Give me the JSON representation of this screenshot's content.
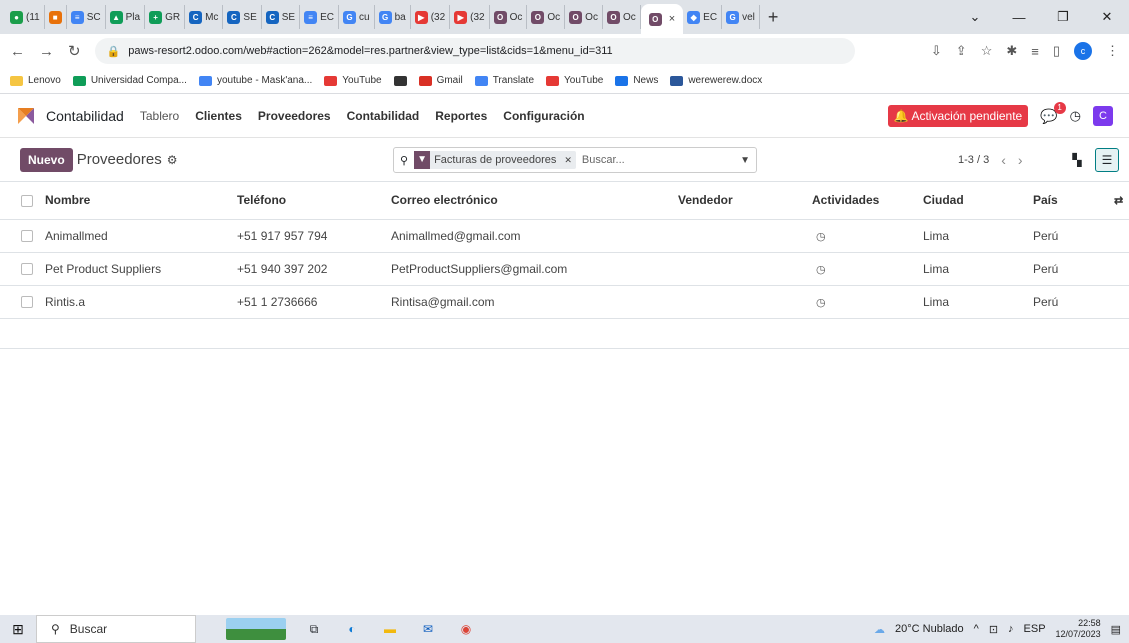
{
  "browser": {
    "tabs": [
      {
        "label": "(11",
        "color": "#1b9e4b",
        "glyph": "●"
      },
      {
        "label": "",
        "color": "#e8710a",
        "glyph": "■"
      },
      {
        "label": "SC",
        "color": "#4285f4",
        "glyph": "≡"
      },
      {
        "label": "Pla",
        "color": "#0f9d58",
        "glyph": "▲"
      },
      {
        "label": "GR",
        "color": "#0f9d58",
        "glyph": "+"
      },
      {
        "label": "Mc",
        "color": "#1565c0",
        "glyph": "C"
      },
      {
        "label": "SE",
        "color": "#1565c0",
        "glyph": "C"
      },
      {
        "label": "SE",
        "color": "#1565c0",
        "glyph": "C"
      },
      {
        "label": "EC",
        "color": "#4285f4",
        "glyph": "≡"
      },
      {
        "label": "cu",
        "color": "#4285f4",
        "glyph": "G"
      },
      {
        "label": "ba",
        "color": "#4285f4",
        "glyph": "G"
      },
      {
        "label": "(32",
        "color": "#e53935",
        "glyph": "▶"
      },
      {
        "label": "(32",
        "color": "#e53935",
        "glyph": "▶"
      },
      {
        "label": "Oc",
        "color": "#714b67",
        "glyph": "O"
      },
      {
        "label": "Oc",
        "color": "#714b67",
        "glyph": "O"
      },
      {
        "label": "Oc",
        "color": "#714b67",
        "glyph": "O"
      },
      {
        "label": "Oc",
        "color": "#714b67",
        "glyph": "O"
      }
    ],
    "active_tab_glyph": "O",
    "after_tabs": [
      {
        "label": "EC",
        "color": "#4285f4",
        "glyph": "◆"
      },
      {
        "label": "vel",
        "color": "#4285f4",
        "glyph": "G"
      }
    ],
    "url": "paws-resort2.odoo.com/web#action=262&model=res.partner&view_type=list&cids=1&menu_id=311",
    "bookmarks": [
      {
        "label": "Lenovo",
        "color": "#f5c542"
      },
      {
        "label": "Universidad Compa...",
        "color": "#0f9d58"
      },
      {
        "label": "youtube - Mask'ana...",
        "color": "#4285f4"
      },
      {
        "label": "YouTube",
        "color": "#e53935"
      },
      {
        "label": "",
        "color": "#333333"
      },
      {
        "label": "Gmail",
        "color": "#d93025"
      },
      {
        "label": "Translate",
        "color": "#4285f4"
      },
      {
        "label": "YouTube",
        "color": "#e53935"
      },
      {
        "label": "News",
        "color": "#1a73e8"
      },
      {
        "label": "werewerew.docx",
        "color": "#2b579a"
      }
    ],
    "profile_initial": "c"
  },
  "odoo": {
    "app_name": "Contabilidad",
    "menu": [
      {
        "label": "Tablero",
        "style": "light"
      },
      {
        "label": "Clientes",
        "style": "bold"
      },
      {
        "label": "Proveedores",
        "style": "bold"
      },
      {
        "label": "Contabilidad",
        "style": "bold"
      },
      {
        "label": "Reportes",
        "style": "bold"
      },
      {
        "label": "Configuración",
        "style": "bold"
      }
    ],
    "activation_label": "Activación pendiente",
    "chat_badge": "1",
    "user_initial": "C",
    "new_button": "Nuevo",
    "breadcrumb": "Proveedores",
    "facet_label": "Facturas de proveedores",
    "search_placeholder": "Buscar...",
    "pager": "1-3 / 3",
    "columns": [
      "Nombre",
      "Teléfono",
      "Correo electrónico",
      "Vendedor",
      "Actividades",
      "Ciudad",
      "País"
    ],
    "rows": [
      {
        "name": "Animallmed",
        "phone": "+51 917 957 794",
        "email": "Animallmed@gmail.com",
        "vendor": "",
        "city": "Lima",
        "country": "Perú"
      },
      {
        "name": "Pet Product Suppliers",
        "phone": "+51 940 397 202",
        "email": "PetProductSuppliers@gmail.com",
        "vendor": "",
        "city": "Lima",
        "country": "Perú"
      },
      {
        "name": "Rintis.a",
        "phone": "+51 1 2736666",
        "email": "Rintisa@gmail.com",
        "vendor": "",
        "city": "Lima",
        "country": "Perú"
      }
    ]
  },
  "taskbar": {
    "search_label": "Buscar",
    "weather": "20°C Nublado",
    "lang": "ESP",
    "time": "22:58",
    "date": "12/07/2023"
  }
}
